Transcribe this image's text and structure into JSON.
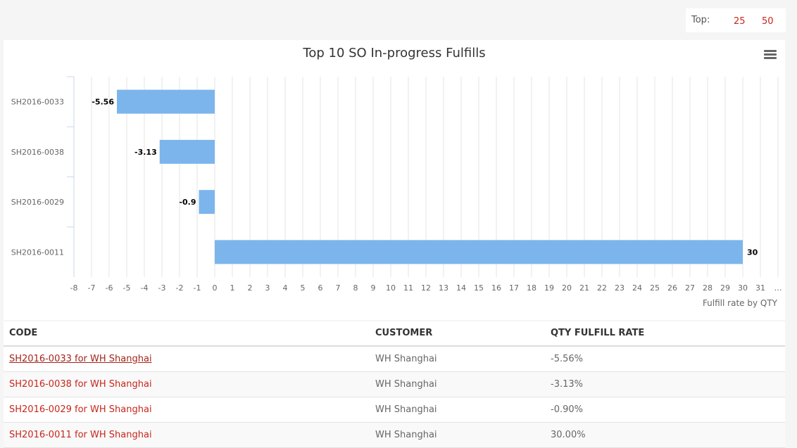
{
  "top_selector": {
    "label": "Top:",
    "options": [
      "25",
      "50"
    ]
  },
  "chart_data": {
    "type": "bar",
    "orientation": "horizontal",
    "title": "Top 10 SO In-progress Fulfills",
    "categories": [
      "SH2016-0033",
      "SH2016-0038",
      "SH2016-0029",
      "SH2016-0011"
    ],
    "values": [
      -5.56,
      -3.13,
      -0.9,
      30
    ],
    "data_labels": [
      "-5.56",
      "-3.13",
      "-0.9",
      "30"
    ],
    "xlabel": "Fulfill rate by QTY",
    "xlim": [
      -8,
      32
    ],
    "ticks": [
      "-8",
      "-7",
      "-6",
      "-5",
      "-4",
      "-3",
      "-2",
      "-1",
      "0",
      "1",
      "2",
      "3",
      "4",
      "5",
      "6",
      "7",
      "8",
      "9",
      "10",
      "11",
      "12",
      "13",
      "14",
      "15",
      "16",
      "17",
      "18",
      "19",
      "20",
      "21",
      "22",
      "23",
      "24",
      "25",
      "26",
      "27",
      "28",
      "29",
      "30",
      "31",
      "…"
    ],
    "grid": true,
    "bar_color": "#7cb5ec"
  },
  "table": {
    "headers": [
      "CODE",
      "CUSTOMER",
      "QTY FULFILL RATE"
    ],
    "rows": [
      {
        "code": "SH2016-0033 for WH Shanghai",
        "customer": "WH Shanghai",
        "rate": "-5.56%"
      },
      {
        "code": "SH2016-0038 for WH Shanghai",
        "customer": "WH Shanghai",
        "rate": "-3.13%"
      },
      {
        "code": "SH2016-0029 for WH Shanghai",
        "customer": "WH Shanghai",
        "rate": "-0.90%"
      },
      {
        "code": "SH2016-0011 for WH Shanghai",
        "customer": "WH Shanghai",
        "rate": "30.00%"
      }
    ]
  }
}
